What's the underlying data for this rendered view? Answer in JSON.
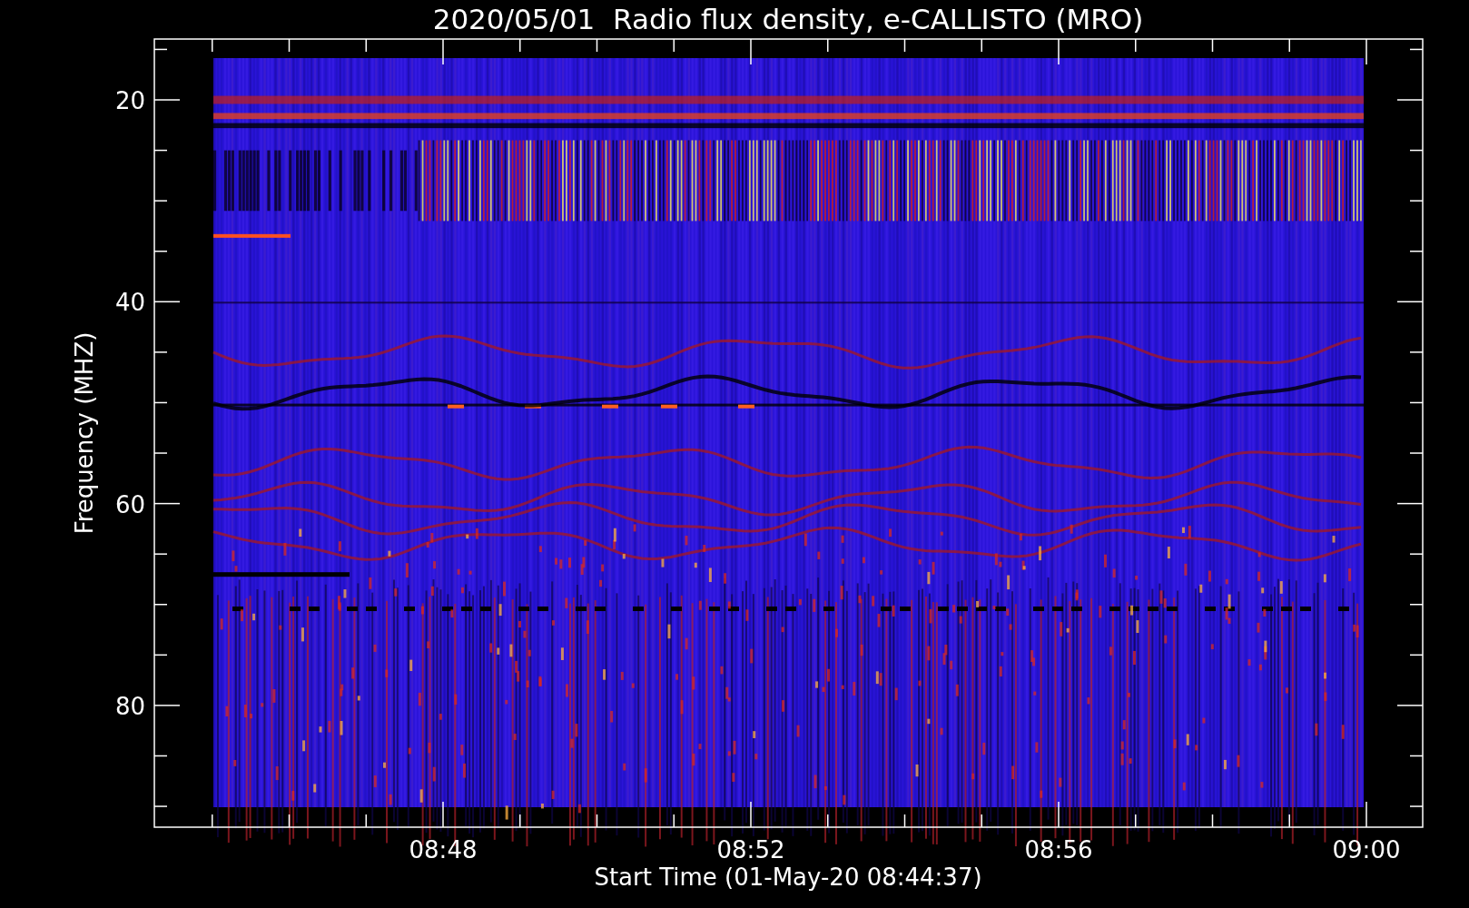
{
  "plot": {
    "title": "2020/05/01  Radio flux density, e-CALLISTO (MRO)",
    "ylabel": "Frequency (MHZ)",
    "xlabel": "Start Time (01-May-20 08:44:37)",
    "yticks": [
      "20",
      "40",
      "60",
      "80"
    ],
    "xticks": [
      "08:48",
      "08:52",
      "08:56",
      "09:00"
    ]
  }
}
